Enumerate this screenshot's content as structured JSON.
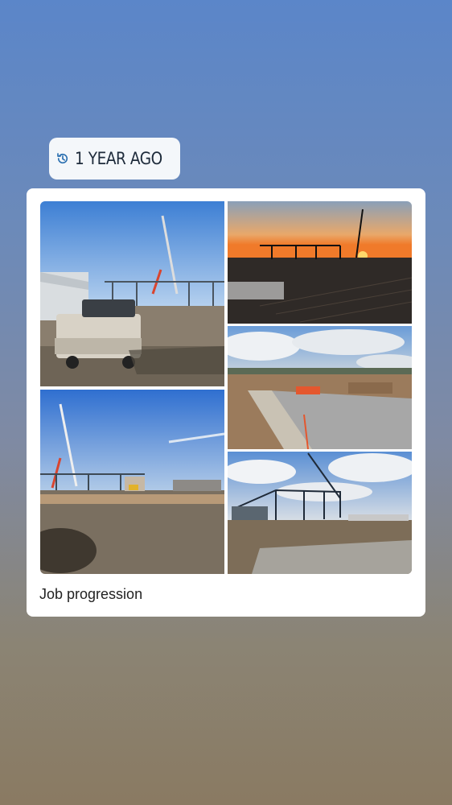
{
  "memory": {
    "label": "1 YEAR AGO",
    "icon": "history-clock-icon"
  },
  "post": {
    "caption": "Job progression",
    "photos": [
      {
        "name": "photo-truck-crane",
        "icon": "photo"
      },
      {
        "name": "photo-sunset-steel-frame",
        "icon": "photo"
      },
      {
        "name": "photo-foundation-footings",
        "icon": "photo"
      },
      {
        "name": "photo-crane-lot",
        "icon": "photo"
      },
      {
        "name": "photo-steel-frame-cloudy",
        "icon": "photo"
      }
    ]
  },
  "colors": {
    "card_bg": "#ffffff",
    "pill_bg": "#f4f7fa",
    "text": "#222222"
  }
}
